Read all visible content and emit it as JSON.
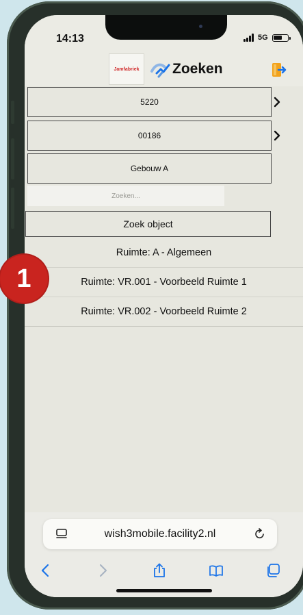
{
  "status_bar": {
    "time": "14:13",
    "network": "5G",
    "signal_icon": "cellular-signal-icon",
    "battery_icon": "battery-icon",
    "battery_level": 0.65
  },
  "header": {
    "brand_logo_text": "Jamfabriek",
    "title": "Zoeken",
    "app_icon": "app-logo-icon",
    "logout_icon": "logout-icon"
  },
  "selectors": [
    {
      "label": "5220",
      "has_chevron": true
    },
    {
      "label": "00186",
      "has_chevron": true
    },
    {
      "label": "Gebouw A",
      "has_chevron": false
    }
  ],
  "search": {
    "placeholder": "Zoeken...",
    "value": "",
    "button_label": "Zoek object"
  },
  "rooms": [
    "Ruimte: A - Algemeen",
    "Ruimte: VR.001 - Voorbeeld Ruimte 1",
    "Ruimte: VR.002 - Voorbeeld Ruimte 2"
  ],
  "browser": {
    "url": "wish3mobile.facility2.nl",
    "icons": {
      "tab": "tab-overview-icon",
      "reload": "reload-icon",
      "back": "back-icon",
      "forward": "forward-icon",
      "share": "share-icon",
      "bookmarks": "bookmarks-icon",
      "tabs": "tabs-icon"
    }
  },
  "callout": {
    "number": "1"
  },
  "colors": {
    "background": "#cfe6ec",
    "screen": "#e7e7df",
    "callout": "#c9241f",
    "accent_blue": "#1a73e8",
    "logout_orange": "#f2a21b"
  }
}
